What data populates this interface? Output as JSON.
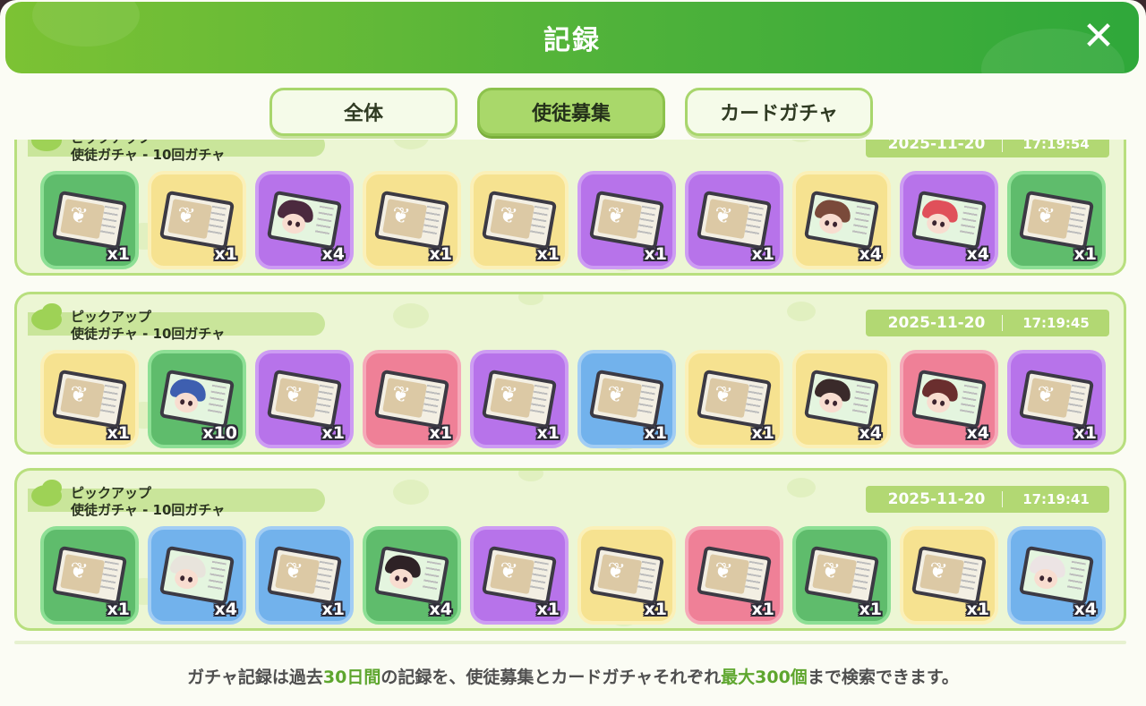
{
  "header": {
    "title": "記録",
    "close_icon": "close-icon"
  },
  "tabs": [
    {
      "label": "全体",
      "active": false
    },
    {
      "label": "使徒募集",
      "active": true
    },
    {
      "label": "カードガチャ",
      "active": false
    }
  ],
  "records": [
    {
      "pickup": "ピックアップ",
      "type": "使徒ガチャ - 10回ガチャ",
      "date": "2025-11-20",
      "time": "17:19:54",
      "items": [
        {
          "rarity": "green",
          "kind": "item",
          "qty": "x1"
        },
        {
          "rarity": "yellow",
          "kind": "item",
          "qty": "x1"
        },
        {
          "rarity": "purple",
          "kind": "character",
          "hair": "#4b2a3e",
          "qty": "x4"
        },
        {
          "rarity": "yellow",
          "kind": "item",
          "qty": "x1"
        },
        {
          "rarity": "yellow",
          "kind": "item",
          "qty": "x1"
        },
        {
          "rarity": "purple",
          "kind": "item",
          "qty": "x1"
        },
        {
          "rarity": "purple",
          "kind": "item",
          "qty": "x1"
        },
        {
          "rarity": "yellow",
          "kind": "character",
          "hair": "#7a4a3a",
          "qty": "x4"
        },
        {
          "rarity": "purple",
          "kind": "character",
          "hair": "#e0505a",
          "qty": "x4"
        },
        {
          "rarity": "green",
          "kind": "item",
          "qty": "x1"
        }
      ]
    },
    {
      "pickup": "ピックアップ",
      "type": "使徒ガチャ - 10回ガチャ",
      "date": "2025-11-20",
      "time": "17:19:45",
      "items": [
        {
          "rarity": "yellow",
          "kind": "item",
          "qty": "x1"
        },
        {
          "rarity": "green",
          "kind": "character",
          "hair": "#3e5fb0",
          "qty": "x10"
        },
        {
          "rarity": "purple",
          "kind": "item",
          "qty": "x1"
        },
        {
          "rarity": "pink",
          "kind": "item",
          "qty": "x1"
        },
        {
          "rarity": "purple",
          "kind": "item",
          "qty": "x1"
        },
        {
          "rarity": "blue",
          "kind": "item",
          "qty": "x1"
        },
        {
          "rarity": "yellow",
          "kind": "item",
          "qty": "x1"
        },
        {
          "rarity": "yellow",
          "kind": "character",
          "hair": "#3a2a2a",
          "qty": "x4"
        },
        {
          "rarity": "pink",
          "kind": "character",
          "hair": "#6a2e2e",
          "qty": "x4"
        },
        {
          "rarity": "purple",
          "kind": "item",
          "qty": "x1"
        }
      ]
    },
    {
      "pickup": "ピックアップ",
      "type": "使徒ガチャ - 10回ガチャ",
      "date": "2025-11-20",
      "time": "17:19:41",
      "items": [
        {
          "rarity": "green",
          "kind": "item",
          "qty": "x1"
        },
        {
          "rarity": "blue",
          "kind": "character",
          "hair": "#e8e4dc",
          "qty": "x4"
        },
        {
          "rarity": "blue",
          "kind": "item",
          "qty": "x1"
        },
        {
          "rarity": "green",
          "kind": "character",
          "hair": "#2e2226",
          "qty": "x4"
        },
        {
          "rarity": "purple",
          "kind": "item",
          "qty": "x1"
        },
        {
          "rarity": "yellow",
          "kind": "item",
          "qty": "x1"
        },
        {
          "rarity": "pink",
          "kind": "item",
          "qty": "x1"
        },
        {
          "rarity": "green",
          "kind": "item",
          "qty": "x1"
        },
        {
          "rarity": "yellow",
          "kind": "item",
          "qty": "x1"
        },
        {
          "rarity": "blue",
          "kind": "character",
          "hair": "#ece4e4",
          "qty": "x4"
        }
      ]
    }
  ],
  "footer": {
    "part1": "ガチャ記録は過去",
    "hl1": "30日間",
    "part2": "の記録を、使徒募集とカードガチャそれぞれ",
    "hl2": "最大300個",
    "part3": "まで検索できます。"
  }
}
